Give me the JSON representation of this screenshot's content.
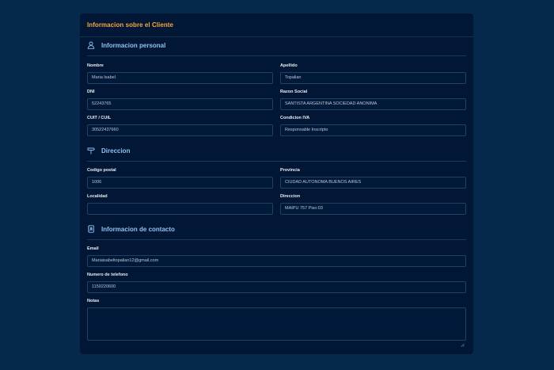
{
  "card": {
    "title": "Informacion sobre el Cliente"
  },
  "personal": {
    "title": "Informacion personal",
    "icon": "user-icon",
    "nombre": {
      "label": "Nombre",
      "value": "Maria Isabel"
    },
    "apellido": {
      "label": "Apellido",
      "value": "Topalian"
    },
    "dni": {
      "label": "DNI",
      "value": "52243765"
    },
    "razon_social": {
      "label": "Razon Social",
      "value": "SANTISTA ARGENTINA SOCIEDAD ANONIMA"
    },
    "cuit": {
      "label": "CUIT / CUIL",
      "value": "30522437660"
    },
    "condicion_iva": {
      "label": "Condicion IVA",
      "value": "Responsable Inscripto"
    }
  },
  "direccion": {
    "title": "Direccion",
    "icon": "signpost-icon",
    "codigo_postal": {
      "label": "Codigo postal",
      "value": "1006"
    },
    "provincia": {
      "label": "Provincia",
      "value": "CIUDAD AUTONOMA BUENOS AIRES"
    },
    "localidad": {
      "label": "Localidad",
      "value": ""
    },
    "direccion": {
      "label": "Direccion",
      "value": "MAIPU 757 Piso:03"
    }
  },
  "contacto": {
    "title": "Informacion de contacto",
    "icon": "phone-book-icon",
    "email": {
      "label": "Email",
      "value": "Mariaisabeltopalian12@gmail.com"
    },
    "telefono": {
      "label": "Numero de telefono",
      "value": "1159220600"
    },
    "notas": {
      "label": "Notas",
      "value": ""
    }
  },
  "colors": {
    "page_bg": "#06284d",
    "card_bg": "#011735",
    "title_accent": "#f5a742",
    "section_title": "#8fc1f2"
  }
}
